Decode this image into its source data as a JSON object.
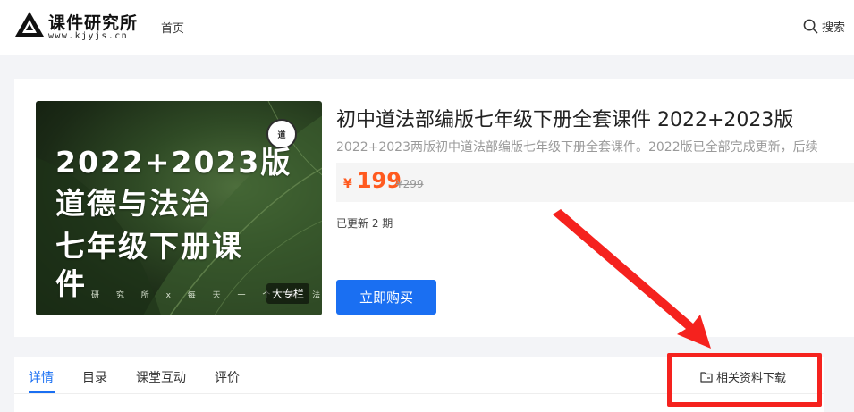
{
  "header": {
    "logo_title": "课件研究所",
    "logo_sub": "www.kjyjs.cn",
    "nav_home": "首页",
    "search_label": "搜索"
  },
  "product": {
    "cover": {
      "line1": "2022+2023版",
      "line2": "道德与法治",
      "line3": "七年级下册课",
      "line4": "件",
      "footer": "研 究 所 x 每 天 一 个 道 法",
      "badge": "道",
      "tag": "大专栏"
    },
    "title": "初中道法部编版七年级下册全套课件 2022+2023版",
    "description": "2022+2023两版初中道法部编版七年级下册全套课件。2022版已全部完成更新，后续",
    "price_symbol": "¥",
    "price": "199",
    "original_price": "¥299",
    "updated": "已更新 2 期",
    "buy_label": "立即购买"
  },
  "tabs": [
    {
      "label": "详情",
      "active": true
    },
    {
      "label": "目录",
      "active": false
    },
    {
      "label": "课堂互动",
      "active": false
    },
    {
      "label": "评价",
      "active": false
    }
  ],
  "download_label": "相关资料下载",
  "colors": {
    "accent": "#1a6ff2",
    "price": "#ff5a1f",
    "annotation": "#f5221e"
  },
  "icons": {
    "search": "search-icon",
    "folder": "folder-icon",
    "logo": "triangle-logo-icon"
  }
}
